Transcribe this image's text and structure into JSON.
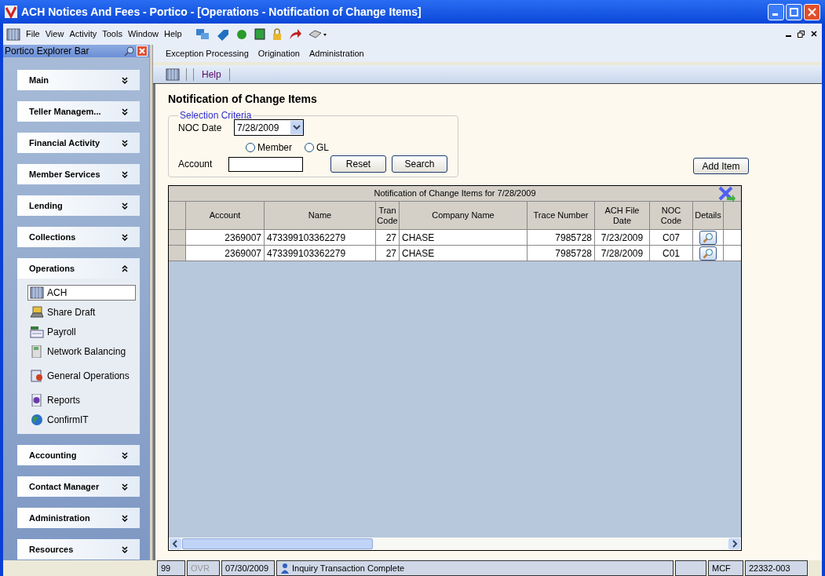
{
  "window": {
    "title": "ACH Notices And Fees - Portico - [Operations - Notification of Change Items]"
  },
  "menu": [
    "File",
    "View",
    "Activity",
    "Tools",
    "Window",
    "Help"
  ],
  "explorer_bar": {
    "title": "Portico Explorer Bar",
    "groups": [
      {
        "label": "Main",
        "expanded": false
      },
      {
        "label": "Teller Managem...",
        "expanded": false
      },
      {
        "label": "Financial Activity",
        "expanded": false
      },
      {
        "label": "Member Services",
        "expanded": false
      },
      {
        "label": "Lending",
        "expanded": false
      },
      {
        "label": "Collections",
        "expanded": false
      },
      {
        "label": "Operations",
        "expanded": true,
        "items": [
          {
            "label": "ACH",
            "selected": true,
            "kind": "ach"
          },
          {
            "label": "Share Draft",
            "selected": false,
            "kind": "draft"
          },
          {
            "label": "Payroll",
            "selected": false,
            "kind": "payroll"
          },
          {
            "label": "Network Balancing",
            "selected": false,
            "kind": "network"
          },
          {
            "label": "General Operations",
            "selected": false,
            "kind": "general"
          },
          {
            "label": "Reports",
            "selected": false,
            "kind": "reports"
          },
          {
            "label": "ConfirmIT",
            "selected": false,
            "kind": "globe"
          }
        ]
      },
      {
        "label": "Accounting",
        "expanded": false
      },
      {
        "label": "Contact Manager",
        "expanded": false
      },
      {
        "label": "Administration",
        "expanded": false
      },
      {
        "label": "Resources",
        "expanded": false
      }
    ]
  },
  "submenu": [
    "Exception Processing",
    "Origination",
    "Administration"
  ],
  "toolbar": {
    "help": "Help"
  },
  "page": {
    "title": "Notification of Change Items",
    "criteria": {
      "legend": "Selection Criteria",
      "noc_date_label": "NOC Date",
      "noc_date": "7/28/2009",
      "radios": [
        {
          "label": "Member",
          "selected": false
        },
        {
          "label": "GL",
          "selected": false
        }
      ],
      "account_label": "Account",
      "buttons": [
        "Reset",
        "Search"
      ]
    },
    "add_button": "Add Item",
    "table": {
      "caption": "Notification of Change Items for 7/28/2009",
      "columns": [
        "Account",
        "Name",
        "Tran Code",
        "Company Name",
        "Trace Number",
        "ACH File Date",
        "NOC Code",
        "Details"
      ],
      "rows": [
        [
          "2369007",
          "473399103362279",
          "27",
          "CHASE",
          "7985728",
          "7/23/2009",
          "C07"
        ],
        [
          "2369007",
          "473399103362279",
          "27",
          "CHASE",
          "7985728",
          "7/28/2009",
          "C01"
        ]
      ]
    }
  },
  "status_bar": [
    "99",
    "OVR",
    "07/30/2009",
    "Inquiry Transaction Complete",
    "MCF",
    "22332-003"
  ]
}
